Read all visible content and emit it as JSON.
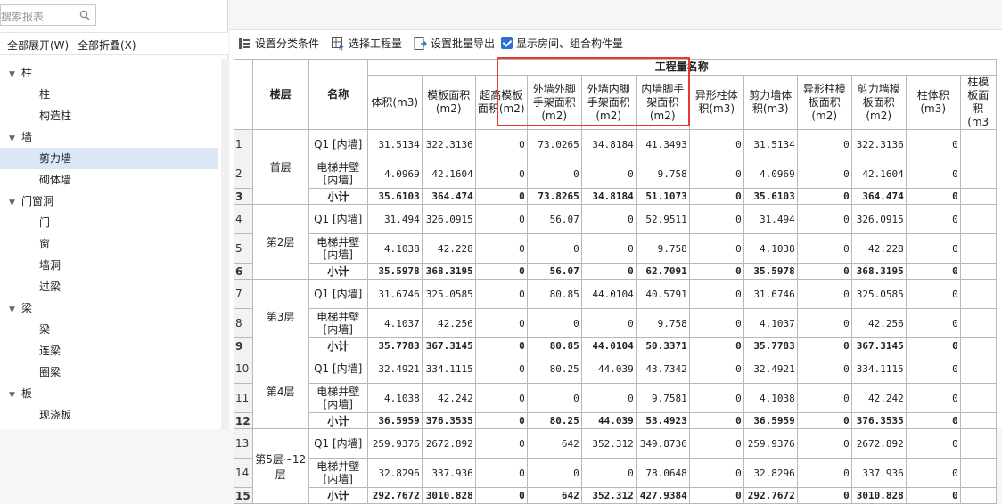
{
  "search": {
    "placeholder": "搜索报表"
  },
  "expand_bar": {
    "expand_all": "全部展开(W)",
    "collapse_all": "全部折叠(X)"
  },
  "tree": [
    {
      "label": "柱",
      "type": "group",
      "name": "tree-group-column"
    },
    {
      "label": "柱",
      "type": "child",
      "name": "tree-item-column"
    },
    {
      "label": "构造柱",
      "type": "child",
      "name": "tree-item-construct-column"
    },
    {
      "label": "墙",
      "type": "group",
      "name": "tree-group-wall"
    },
    {
      "label": "剪力墙",
      "type": "child",
      "selected": true,
      "name": "tree-item-shear-wall"
    },
    {
      "label": "砌体墙",
      "type": "child",
      "name": "tree-item-masonry-wall"
    },
    {
      "label": "门窗洞",
      "type": "group",
      "name": "tree-group-openings"
    },
    {
      "label": "门",
      "type": "child",
      "name": "tree-item-door"
    },
    {
      "label": "窗",
      "type": "child",
      "name": "tree-item-window"
    },
    {
      "label": "墙洞",
      "type": "child",
      "name": "tree-item-wall-hole"
    },
    {
      "label": "过梁",
      "type": "child",
      "name": "tree-item-lintel"
    },
    {
      "label": "梁",
      "type": "group",
      "name": "tree-group-beam"
    },
    {
      "label": "梁",
      "type": "child",
      "name": "tree-item-beam"
    },
    {
      "label": "连梁",
      "type": "child",
      "name": "tree-item-coupling-beam"
    },
    {
      "label": "圈梁",
      "type": "child",
      "name": "tree-item-ring-beam"
    },
    {
      "label": "板",
      "type": "group",
      "name": "tree-group-slab"
    },
    {
      "label": "现浇板",
      "type": "child",
      "name": "tree-item-cast-slab"
    }
  ],
  "toolbar": {
    "set_category": "设置分类条件",
    "select_project": "选择工程量",
    "batch_export": "设置批量导出",
    "show_rooms": "显示房间、组合构件量"
  },
  "table": {
    "h_floor": "楼层",
    "h_name": "名称",
    "h_group": "工程量名称",
    "columns": [
      "体积(m3)",
      "模板面积(m2)",
      "超高模板面积(m2)",
      "外墙外脚手架面积(m2)",
      "外墙内脚手架面积(m2)",
      "内墙脚手架面积(m2)",
      "异形柱体积(m3)",
      "剪力墙体积(m3)",
      "异形柱模板面积(m2)",
      "剪力墙模板面积(m2)",
      "柱体积(m3)",
      "柱模板面积(m3"
    ],
    "floors": [
      {
        "floor": "首层",
        "rows": [
          {
            "n": "1",
            "name": "Q1 [内墙]",
            "v": [
              "31.5134",
              "322.3136",
              "0",
              "73.0265",
              "34.8184",
              "41.3493",
              "0",
              "31.5134",
              "0",
              "322.3136",
              "0",
              ""
            ]
          },
          {
            "n": "2",
            "name": "电梯井壁[内墙]",
            "v": [
              "4.0969",
              "42.1604",
              "0",
              "0",
              "0",
              "9.758",
              "0",
              "4.0969",
              "0",
              "42.1604",
              "0",
              ""
            ]
          },
          {
            "n": "3",
            "name": "小计",
            "sub": true,
            "v": [
              "35.6103",
              "364.474",
              "0",
              "73.8265",
              "34.8184",
              "51.1073",
              "0",
              "35.6103",
              "0",
              "364.474",
              "0",
              ""
            ]
          }
        ]
      },
      {
        "floor": "第2层",
        "rows": [
          {
            "n": "4",
            "name": "Q1 [内墙]",
            "v": [
              "31.494",
              "326.0915",
              "0",
              "56.07",
              "0",
              "52.9511",
              "0",
              "31.494",
              "0",
              "326.0915",
              "0",
              ""
            ]
          },
          {
            "n": "5",
            "name": "电梯井壁[内墙]",
            "v": [
              "4.1038",
              "42.228",
              "0",
              "0",
              "0",
              "9.758",
              "0",
              "4.1038",
              "0",
              "42.228",
              "0",
              ""
            ]
          },
          {
            "n": "6",
            "name": "小计",
            "sub": true,
            "v": [
              "35.5978",
              "368.3195",
              "0",
              "56.07",
              "0",
              "62.7091",
              "0",
              "35.5978",
              "0",
              "368.3195",
              "0",
              ""
            ]
          }
        ]
      },
      {
        "floor": "第3层",
        "rows": [
          {
            "n": "7",
            "name": "Q1 [内墙]",
            "v": [
              "31.6746",
              "325.0585",
              "0",
              "80.85",
              "44.0104",
              "40.5791",
              "0",
              "31.6746",
              "0",
              "325.0585",
              "0",
              ""
            ]
          },
          {
            "n": "8",
            "name": "电梯井壁[内墙]",
            "v": [
              "4.1037",
              "42.256",
              "0",
              "0",
              "0",
              "9.758",
              "0",
              "4.1037",
              "0",
              "42.256",
              "0",
              ""
            ]
          },
          {
            "n": "9",
            "name": "小计",
            "sub": true,
            "v": [
              "35.7783",
              "367.3145",
              "0",
              "80.85",
              "44.0104",
              "50.3371",
              "0",
              "35.7783",
              "0",
              "367.3145",
              "0",
              ""
            ]
          }
        ]
      },
      {
        "floor": "第4层",
        "rows": [
          {
            "n": "10",
            "name": "Q1 [内墙]",
            "v": [
              "32.4921",
              "334.1115",
              "0",
              "80.25",
              "44.039",
              "43.7342",
              "0",
              "32.4921",
              "0",
              "334.1115",
              "0",
              ""
            ]
          },
          {
            "n": "11",
            "name": "电梯井壁[内墙]",
            "v": [
              "4.1038",
              "42.242",
              "0",
              "0",
              "0",
              "9.7581",
              "0",
              "4.1038",
              "0",
              "42.242",
              "0",
              ""
            ]
          },
          {
            "n": "12",
            "name": "小计",
            "sub": true,
            "v": [
              "36.5959",
              "376.3535",
              "0",
              "80.25",
              "44.039",
              "53.4923",
              "0",
              "36.5959",
              "0",
              "376.3535",
              "0",
              ""
            ]
          }
        ]
      },
      {
        "floor": "第5层~12层",
        "rows": [
          {
            "n": "13",
            "name": "Q1 [内墙]",
            "v": [
              "259.9376",
              "2672.892",
              "0",
              "642",
              "352.312",
              "349.8736",
              "0",
              "259.9376",
              "0",
              "2672.892",
              "0",
              ""
            ]
          },
          {
            "n": "14",
            "name": "电梯井壁[内墙]",
            "v": [
              "32.8296",
              "337.936",
              "0",
              "0",
              "0",
              "78.0648",
              "0",
              "32.8296",
              "0",
              "337.936",
              "0",
              ""
            ]
          },
          {
            "n": "15",
            "name": "小计",
            "sub": true,
            "v": [
              "292.7672",
              "3010.828",
              "0",
              "642",
              "352.312",
              "427.9384",
              "0",
              "292.7672",
              "0",
              "3010.828",
              "0",
              ""
            ]
          }
        ]
      }
    ]
  },
  "colors": {
    "highlight": "#e53935",
    "selected_bg": "#dbe6f7",
    "accent": "#2f6fd6"
  }
}
